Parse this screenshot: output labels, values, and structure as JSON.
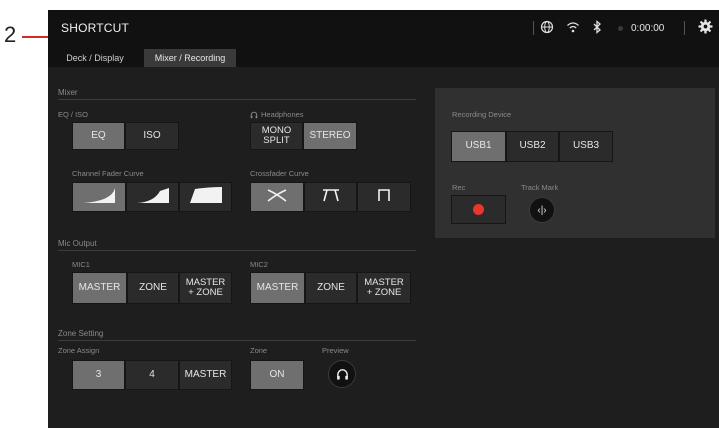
{
  "callout": {
    "number": "2"
  },
  "app": {
    "title": "SHORTCUT",
    "time": "0:00:00"
  },
  "topbar_icons": [
    "globe-icon",
    "wifi-icon",
    "bluetooth-icon",
    "gear-icon"
  ],
  "tabs": [
    {
      "label": "Deck / Display",
      "active": false
    },
    {
      "label": "Mixer / Recording",
      "active": true
    }
  ],
  "mixer": {
    "section_label": "Mixer",
    "eq_iso": {
      "label": "EQ / ISO",
      "options": [
        "EQ",
        "ISO"
      ],
      "selected": "EQ"
    },
    "headphones": {
      "label": "Headphones",
      "options": [
        [
          "MONO",
          "SPLIT"
        ],
        [
          "STEREO"
        ]
      ],
      "selected": "STEREO"
    },
    "channel_fader_curve": {
      "label": "Channel Fader Curve",
      "options": [
        "slow-curve-icon",
        "linear-curve-icon",
        "fast-curve-icon"
      ],
      "selected": 0
    },
    "crossfader_curve": {
      "label": "Crossfader Curve",
      "options": [
        "crossfader-blend-icon",
        "crossfader-cut-icon",
        "crossfader-sharp-icon"
      ],
      "selected": 0
    }
  },
  "mic_output": {
    "section_label": "Mic Output",
    "mic1": {
      "label": "MIC1",
      "options": [
        [
          "MASTER"
        ],
        [
          "ZONE"
        ],
        [
          "MASTER",
          "+ ZONE"
        ]
      ],
      "selected": 0
    },
    "mic2": {
      "label": "MIC2",
      "options": [
        [
          "MASTER"
        ],
        [
          "ZONE"
        ],
        [
          "MASTER",
          "+ ZONE"
        ]
      ],
      "selected": 0
    }
  },
  "zone_setting": {
    "section_label": "Zone Setting",
    "zone_assign": {
      "label": "Zone Assign",
      "options": [
        "3",
        "4",
        "MASTER"
      ],
      "selected": 0
    },
    "zone": {
      "label": "Zone",
      "button": "ON",
      "on": true
    },
    "preview": {
      "label": "Preview",
      "icon": "headphones-icon"
    }
  },
  "recording": {
    "device_label": "Recording Device",
    "devices": [
      "USB1",
      "USB2",
      "USB3"
    ],
    "selected": 0,
    "rec_label": "Rec",
    "track_mark_label": "Track Mark",
    "track_mark_glyph": "‹|›"
  }
}
